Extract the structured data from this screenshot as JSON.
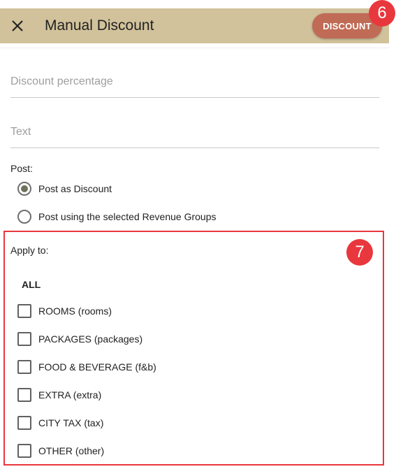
{
  "header": {
    "title": "Manual Discount",
    "close_icon": "close-icon",
    "discount_button": "DISCOUNT",
    "badge": "6",
    "background": "#d2c29c",
    "button_color": "#c06b55"
  },
  "form": {
    "discount_percentage_placeholder": "Discount percentage",
    "text_placeholder": "Text"
  },
  "post": {
    "label": "Post:",
    "options": [
      {
        "label": "Post as Discount",
        "selected": true
      },
      {
        "label": "Post using the selected Revenue Groups",
        "selected": false
      }
    ]
  },
  "apply": {
    "badge": "7",
    "label": "Apply to:",
    "all_label": "ALL",
    "items": [
      {
        "label": "ROOMS (rooms)",
        "checked": false
      },
      {
        "label": "PACKAGES (packages)",
        "checked": false
      },
      {
        "label": "FOOD & BEVERAGE (f&b)",
        "checked": false
      },
      {
        "label": "EXTRA (extra)",
        "checked": false
      },
      {
        "label": "CITY TAX (tax)",
        "checked": false
      },
      {
        "label": "OTHER (other)",
        "checked": false
      }
    ],
    "highlight_color": "#e8383d"
  }
}
